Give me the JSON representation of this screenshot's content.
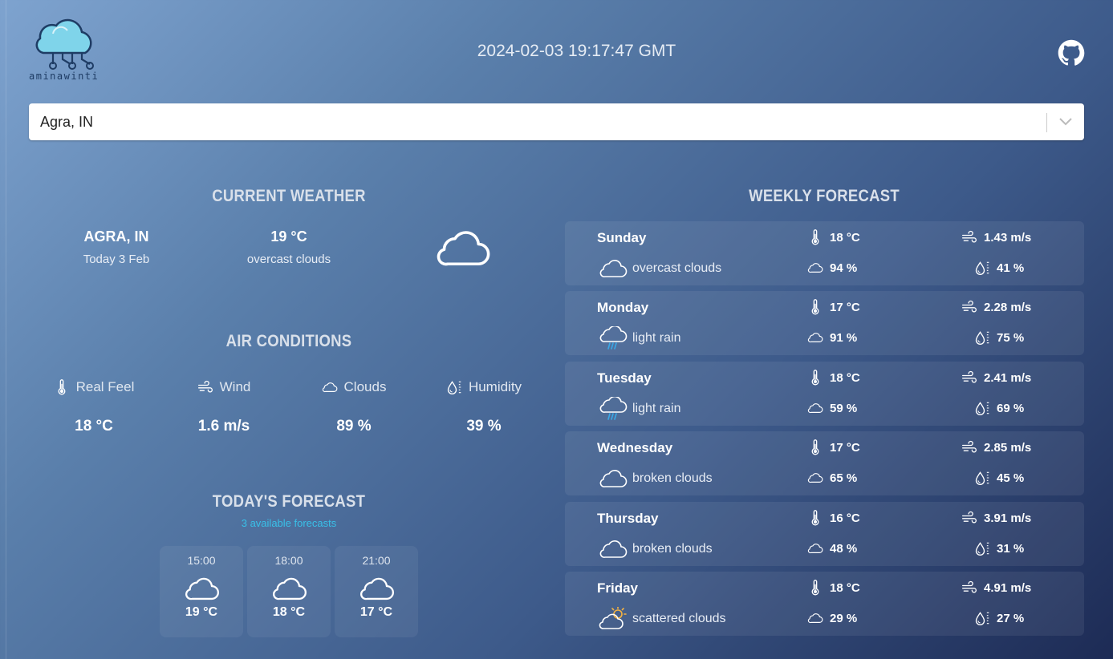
{
  "app": {
    "logo_text": "aminawinti",
    "datetime": "2024-02-03 19:17:47 GMT"
  },
  "search": {
    "value": "Agra, IN"
  },
  "current": {
    "title": "CURRENT WEATHER",
    "city": "AGRA, IN",
    "date": "Today 3 Feb",
    "temp": "19 °C",
    "description": "overcast clouds",
    "icon": "cloud-icon"
  },
  "air": {
    "title": "AIR CONDITIONS",
    "items": [
      {
        "label": "Real Feel",
        "value": "18 °C",
        "icon": "thermometer-icon"
      },
      {
        "label": "Wind",
        "value": "1.6 m/s",
        "icon": "wind-icon"
      },
      {
        "label": "Clouds",
        "value": "89 %",
        "icon": "cloud-icon"
      },
      {
        "label": "Humidity",
        "value": "39 %",
        "icon": "humidity-icon"
      }
    ]
  },
  "today": {
    "title": "TODAY'S FORECAST",
    "subtitle": "3 available forecasts",
    "items": [
      {
        "time": "15:00",
        "temp": "19 °C",
        "icon": "cloud-icon"
      },
      {
        "time": "18:00",
        "temp": "18 °C",
        "icon": "cloud-icon"
      },
      {
        "time": "21:00",
        "temp": "17 °C",
        "icon": "cloud-icon"
      }
    ]
  },
  "weekly": {
    "title": "WEEKLY FORECAST",
    "days": [
      {
        "day": "Sunday",
        "desc": "overcast clouds",
        "icon": "cloud-icon",
        "temp": "18 °C",
        "wind": "1.43 m/s",
        "clouds": "94 %",
        "humidity": "41 %"
      },
      {
        "day": "Monday",
        "desc": "light rain",
        "icon": "rain-cloud-icon",
        "temp": "17 °C",
        "wind": "2.28 m/s",
        "clouds": "91 %",
        "humidity": "75 %"
      },
      {
        "day": "Tuesday",
        "desc": "light rain",
        "icon": "rain-cloud-icon",
        "temp": "18 °C",
        "wind": "2.41 m/s",
        "clouds": "59 %",
        "humidity": "69 %"
      },
      {
        "day": "Wednesday",
        "desc": "broken clouds",
        "icon": "cloud-icon",
        "temp": "17 °C",
        "wind": "2.85 m/s",
        "clouds": "65 %",
        "humidity": "45 %"
      },
      {
        "day": "Thursday",
        "desc": "broken clouds",
        "icon": "cloud-icon",
        "temp": "16 °C",
        "wind": "3.91 m/s",
        "clouds": "48 %",
        "humidity": "31 %"
      },
      {
        "day": "Friday",
        "desc": "scattered clouds",
        "icon": "sun-cloud-icon",
        "temp": "18 °C",
        "wind": "4.91 m/s",
        "clouds": "29 %",
        "humidity": "27 %"
      }
    ]
  },
  "colors": {
    "accent": "#39c0e8",
    "bg_top": "#7ea3cf",
    "bg_bottom": "#1d2b55"
  }
}
